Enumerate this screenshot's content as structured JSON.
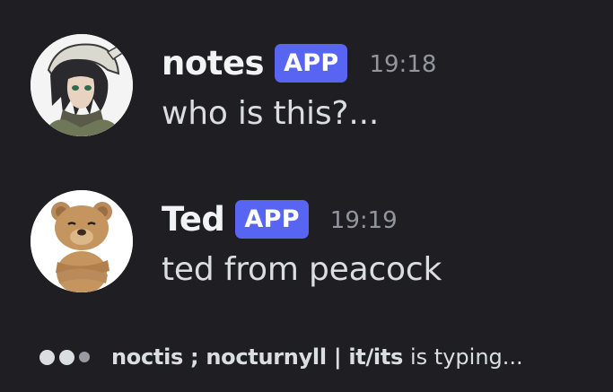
{
  "messages": [
    {
      "username": "notes",
      "badge": "APP",
      "timestamp": "19:18",
      "content": "who is this?...",
      "avatar_icon": "anime-character-avatar"
    },
    {
      "username": "Ted",
      "badge": "APP",
      "timestamp": "19:19",
      "content": "ted from peacock",
      "avatar_icon": "teddy-bear-avatar"
    }
  ],
  "typing_indicator": {
    "name": "noctis ; nocturnyll | it/its",
    "suffix": "is typing..."
  },
  "colors": {
    "background": "#1f1f23",
    "badge": "#5865f2",
    "username": "#f2f3f5",
    "text": "#dbdee1",
    "timestamp": "#94959c"
  }
}
